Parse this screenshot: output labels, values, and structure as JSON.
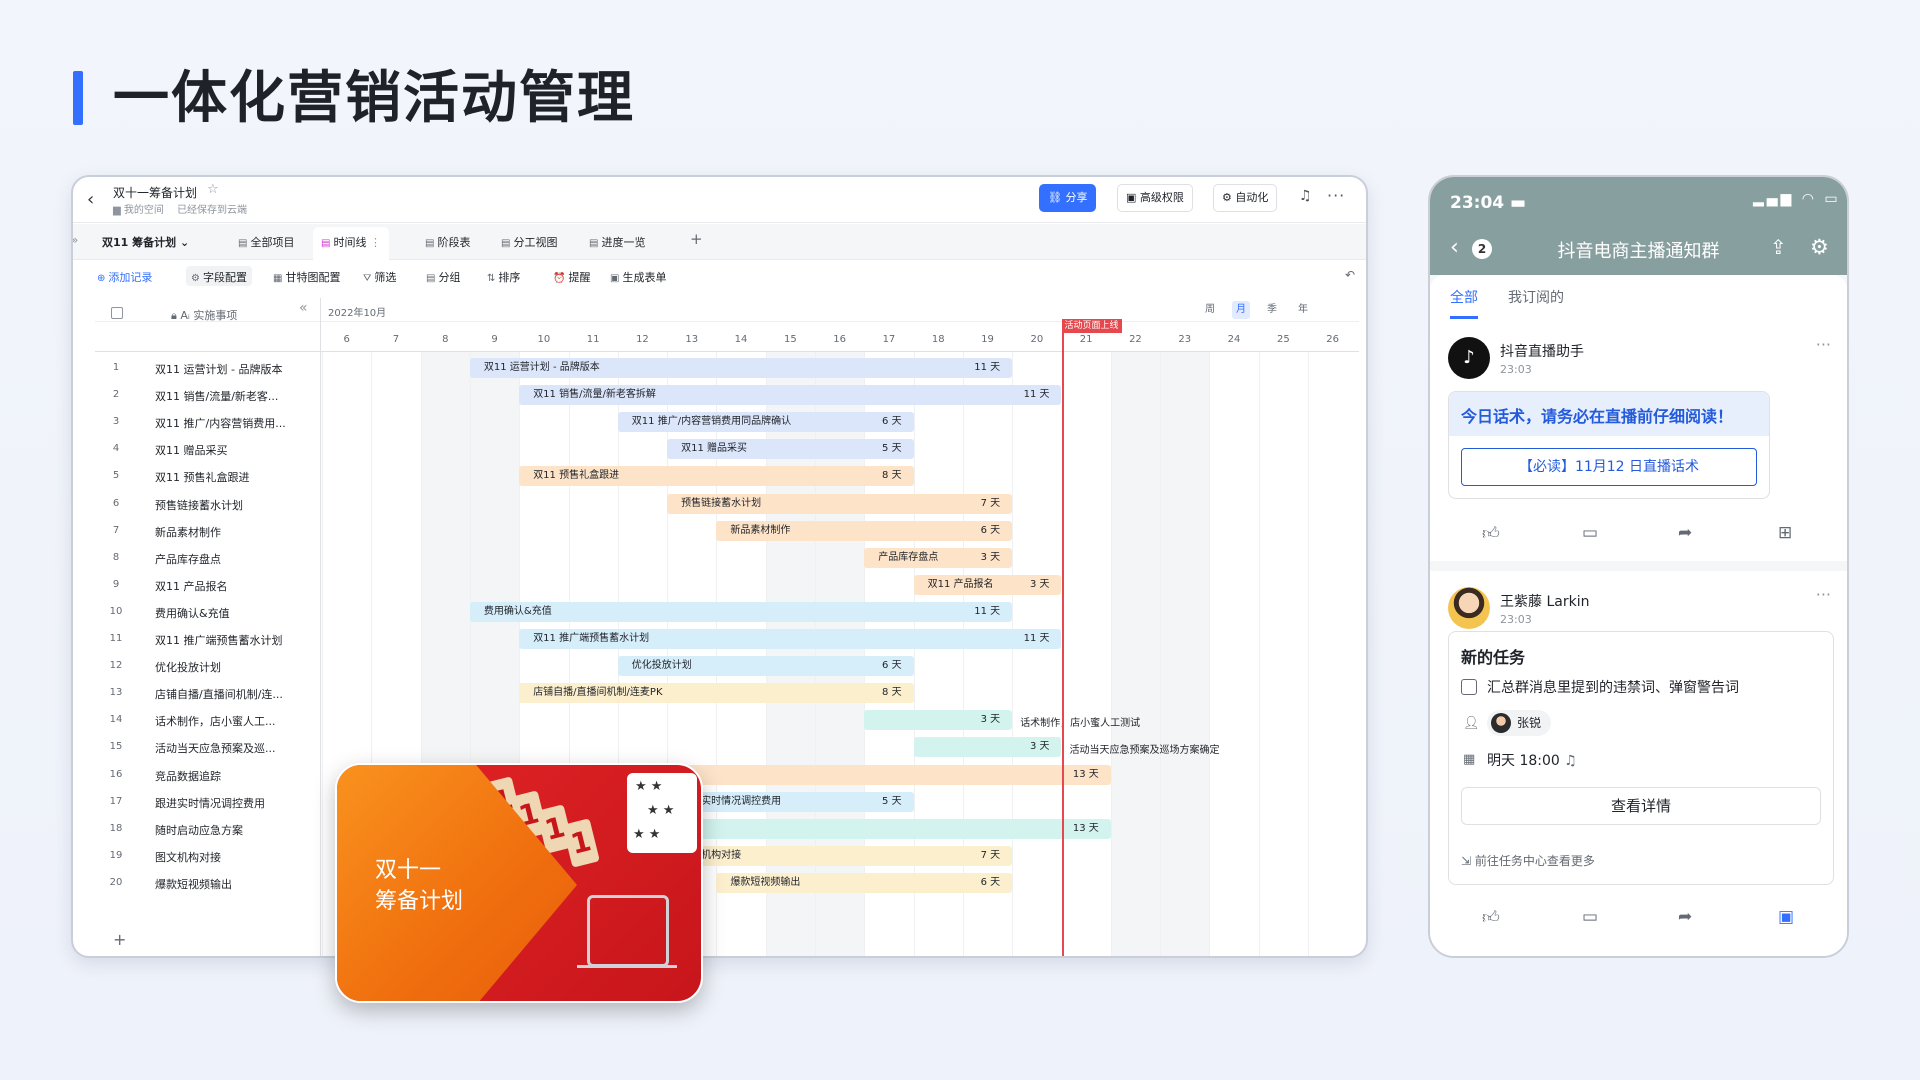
{
  "page": {
    "title": "一体化营销活动管理",
    "accent": "#3370ff"
  },
  "doc": {
    "title": "双十一筹备计划",
    "space": "我的空间",
    "saved": "已经保存到云端",
    "share": "分享",
    "permission": "高级权限",
    "automation": "自动化"
  },
  "tabs": {
    "plan": "双11 筹备计划",
    "all": "全部项目",
    "timeline": "时间线",
    "stage": "阶段表",
    "division": "分工视图",
    "progress": "进度一览"
  },
  "toolbar": {
    "add": "添加记录",
    "field": "字段配置",
    "gantt": "甘特图配置",
    "filter": "筛选",
    "group": "分组",
    "sort": "排序",
    "remind": "提醒",
    "form": "生成表单"
  },
  "grid": {
    "month": "2022年10月",
    "task_col": "Aᵢ 实施事项",
    "zoom": [
      "周",
      "月",
      "季",
      "年"
    ],
    "zoom_active": 1,
    "days": [
      6,
      7,
      8,
      9,
      10,
      11,
      12,
      13,
      14,
      15,
      16,
      17,
      18,
      19,
      20,
      21,
      22,
      23,
      24,
      25,
      26
    ],
    "weekend_days": [
      8,
      9,
      15,
      16,
      22,
      23
    ],
    "today_day": 21,
    "today_label": "活动页面上线",
    "rows": [
      {
        "n": 1,
        "name": "双11 运营计划 - 品牌版本",
        "label": "双11 运营计划 - 品牌版本",
        "start": 9,
        "end": 19,
        "dur": "11 天",
        "color": "blue"
      },
      {
        "n": 2,
        "name": "双11 销售/流量/新老客...",
        "label": "双11 销售/流量/新老客拆解",
        "start": 10,
        "end": 20,
        "dur": "11 天",
        "color": "blue"
      },
      {
        "n": 3,
        "name": "双11 推广/内容营销费用...",
        "label": "双11 推广/内容营销费用同品牌确认",
        "start": 12,
        "end": 17,
        "dur": "6 天",
        "color": "blue"
      },
      {
        "n": 4,
        "name": "双11 赠品采买",
        "label": "双11 赠品采买",
        "start": 13,
        "end": 17,
        "dur": "5 天",
        "color": "blue"
      },
      {
        "n": 5,
        "name": "双11 预售礼盒跟进",
        "label": "双11 预售礼盒跟进",
        "start": 10,
        "end": 17,
        "dur": "8 天",
        "color": "orange"
      },
      {
        "n": 6,
        "name": "预售链接蓄水计划",
        "label": "预售链接蓄水计划",
        "start": 13,
        "end": 19,
        "dur": "7 天",
        "color": "orange"
      },
      {
        "n": 7,
        "name": "新品素材制作",
        "label": "新品素材制作",
        "start": 14,
        "end": 19,
        "dur": "6 天",
        "color": "orange"
      },
      {
        "n": 8,
        "name": "产品库存盘点",
        "label": "产品库存盘点",
        "start": 17,
        "end": 19,
        "dur": "3 天",
        "color": "orange"
      },
      {
        "n": 9,
        "name": "双11 产品报名",
        "label": "双11 产品报名",
        "start": 18,
        "end": 20,
        "dur": "3 天",
        "color": "orange"
      },
      {
        "n": 10,
        "name": "费用确认&充值",
        "label": "费用确认&充值",
        "start": 9,
        "end": 19,
        "dur": "11 天",
        "color": "cyan"
      },
      {
        "n": 11,
        "name": "双11 推广端预售蓄水计划",
        "label": "双11 推广端预售蓄水计划",
        "start": 10,
        "end": 20,
        "dur": "11 天",
        "color": "cyan"
      },
      {
        "n": 12,
        "name": "优化投放计划",
        "label": "优化投放计划",
        "start": 12,
        "end": 17,
        "dur": "6 天",
        "color": "cyan"
      },
      {
        "n": 13,
        "name": "店铺自播/直播间机制/连...",
        "label": "店铺自播/直播间机制/连麦PK",
        "start": 10,
        "end": 17,
        "dur": "8 天",
        "color": "yellow"
      },
      {
        "n": 14,
        "name": "话术制作，店小蜜人工...",
        "label": "",
        "start": 17,
        "end": 19,
        "dur": "3 天",
        "color": "teal",
        "after": "话术制作，店小蜜人工测试"
      },
      {
        "n": 15,
        "name": "活动当天应急预案及巡...",
        "label": "",
        "start": 18,
        "end": 20,
        "dur": "3 天",
        "color": "teal",
        "after": "活动当天应急预案及巡场方案确定"
      },
      {
        "n": 16,
        "name": "竞品数据追踪",
        "label": "",
        "start": 9,
        "end": 21,
        "dur": "13 天",
        "color": "orange"
      },
      {
        "n": 17,
        "name": "跟进实时情况调控费用",
        "label": "跟进实时情况调控费用",
        "start": 13,
        "end": 17,
        "dur": "5 天",
        "color": "cyan"
      },
      {
        "n": 18,
        "name": "随时启动应急方案",
        "label": "",
        "start": 9,
        "end": 21,
        "dur": "13 天",
        "color": "teal"
      },
      {
        "n": 19,
        "name": "图文机构对接",
        "label": "图文机构对接",
        "start": 13,
        "end": 19,
        "dur": "7 天",
        "color": "yellow"
      },
      {
        "n": 20,
        "name": "爆款短视频输出",
        "label": "爆款短视频输出",
        "start": 14,
        "end": 19,
        "dur": "6 天",
        "color": "yellow"
      }
    ]
  },
  "promo": {
    "title": "双十一筹备计划",
    "line1": "双十一",
    "line2": "筹备计划",
    "number": "1111"
  },
  "phone": {
    "time": "23:04",
    "status": "▂▄▆ ◠ ▭",
    "badge": "2",
    "group": "抖音电商主播通知群",
    "tab_all": "全部",
    "tab_sub": "我订阅的",
    "msg1": {
      "avatar_text": "抖音",
      "sender": "抖音直播助手",
      "time": "23:03",
      "headline": "今日话术，请务必在直播前仔细阅读！",
      "button": "【必读】11月12 日直播话术"
    },
    "msg2": {
      "sender": "王紫藤 Larkin",
      "time": "23:03",
      "task_title": "新的任务",
      "task": "汇总群消息里提到的违禁词、弹窗警告词",
      "assignee": "张锐",
      "due": "明天 18:00",
      "detail": "查看详情",
      "more": "前往任务中心查看更多"
    }
  }
}
